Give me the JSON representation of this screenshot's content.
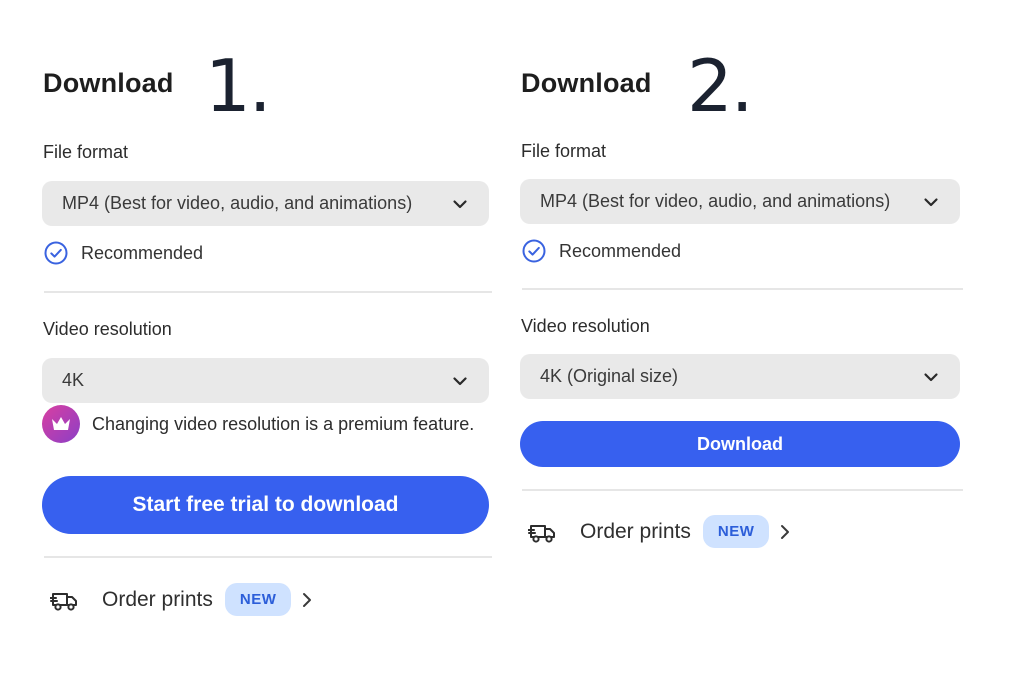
{
  "panels": [
    {
      "title": "Download",
      "step": "1.",
      "file_format_label": "File format",
      "file_format_value": "MP4 (Best for video, audio, and animations)",
      "recommended": "Recommended",
      "resolution_label": "Video resolution",
      "resolution_value": "4K",
      "premium_notice": "Changing video resolution is a premium feature.",
      "cta": "Start free trial to download",
      "order_prints": "Order prints",
      "new_badge": "NEW"
    },
    {
      "title": "Download",
      "step": "2.",
      "file_format_label": "File format",
      "file_format_value": "MP4 (Best for video, audio, and animations)",
      "recommended": "Recommended",
      "resolution_label": "Video resolution",
      "resolution_value": "4K (Original size)",
      "cta": "Download",
      "order_prints": "Order prints",
      "new_badge": "NEW"
    }
  ],
  "colors": {
    "accent": "#3760ef",
    "dropdown_bg": "#e9e9e9",
    "new_badge_bg": "#cfe2ff",
    "new_badge_text": "#2c5ed9",
    "premium_gradient_start": "#d93fa1",
    "premium_gradient_end": "#8b3fc6"
  },
  "icons": [
    "check-circle-icon",
    "chevron-down-icon",
    "crown-icon",
    "truck-icon",
    "chevron-right-icon"
  ]
}
